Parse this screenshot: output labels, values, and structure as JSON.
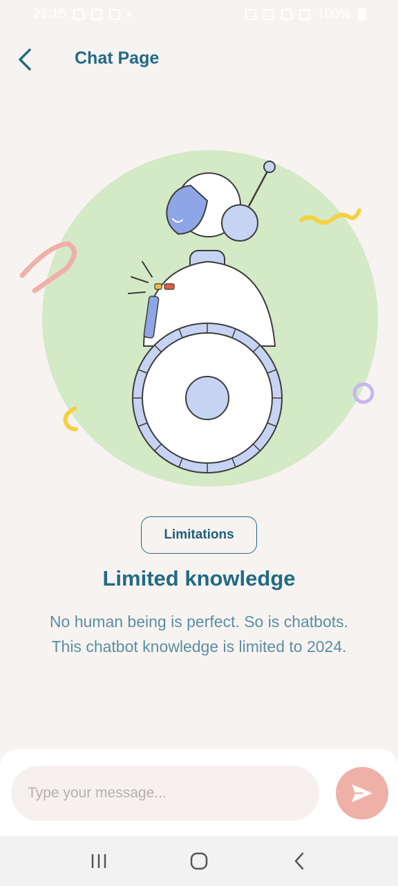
{
  "status_bar": {
    "time": "21:15",
    "battery": "100%"
  },
  "header": {
    "title": "Chat Page",
    "back_icon": "chevron-left-icon"
  },
  "content": {
    "chip_label": "Limitations",
    "heading": "Limited knowledge",
    "description": "No human being is perfect. So is chatbots. This chatbot knowledge is limited to 2024."
  },
  "composer": {
    "placeholder": "Type your message...",
    "value": "",
    "send_icon": "send-icon"
  },
  "nav": {
    "recents_icon": "recents-icon",
    "home_icon": "home-icon",
    "back_icon": "back-icon"
  },
  "colors": {
    "background": "#f7f3f1",
    "primary": "#216a84",
    "send_button": "#efb0a8",
    "illustration_circle": "#d4e9c6",
    "robot_accent": "#8ea6e6"
  }
}
